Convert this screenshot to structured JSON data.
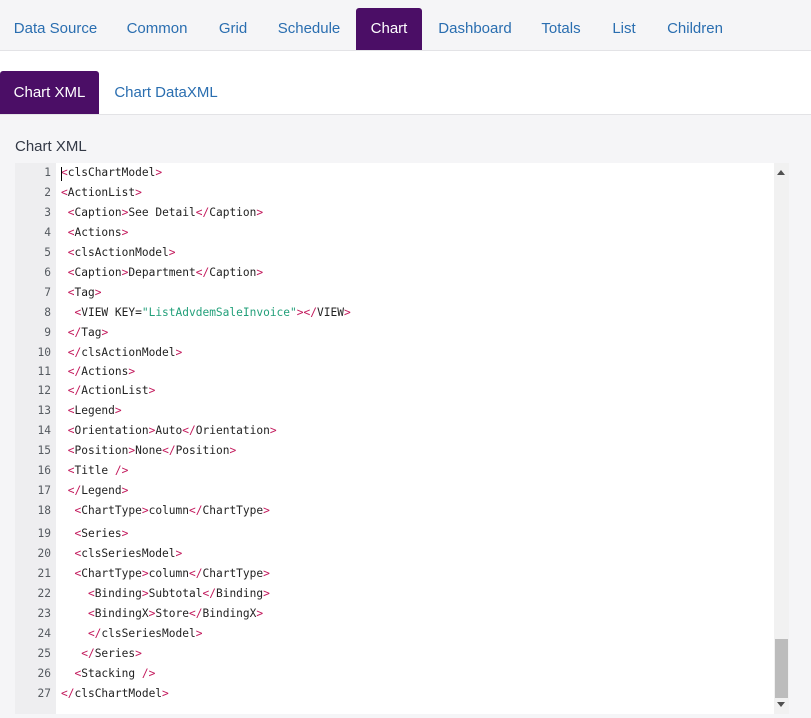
{
  "top_tabs": [
    {
      "label": "Data Source"
    },
    {
      "label": "Common"
    },
    {
      "label": "Grid"
    },
    {
      "label": "Schedule"
    },
    {
      "label": "Chart",
      "active": true
    },
    {
      "label": "Dashboard"
    },
    {
      "label": "Totals"
    },
    {
      "label": "List"
    },
    {
      "label": "Children"
    }
  ],
  "sub_tabs": [
    {
      "label": "Chart XML",
      "active": true
    },
    {
      "label": "Chart DataXML"
    }
  ],
  "section_label": "Chart XML",
  "editor": {
    "line_numbers": [
      "1",
      "2",
      "3",
      "4",
      "5",
      "6",
      "7",
      "8",
      "9",
      "10",
      "11",
      "12",
      "13",
      "14",
      "15",
      "16",
      "17",
      "18",
      "19",
      "20",
      "21",
      "22",
      "23",
      "24",
      "25",
      "26",
      "27"
    ],
    "lines": [
      [
        {
          "t": "<",
          "c": "b"
        },
        {
          "t": "clsChartModel",
          "c": "tag"
        },
        {
          "t": ">",
          "c": "b"
        }
      ],
      [
        {
          "t": "<",
          "c": "b"
        },
        {
          "t": "ActionList",
          "c": "tag"
        },
        {
          "t": ">",
          "c": "b"
        }
      ],
      [
        {
          "t": " <",
          "c": "b"
        },
        {
          "t": "Caption",
          "c": "tag"
        },
        {
          "t": ">",
          "c": "b"
        },
        {
          "t": "See Detail",
          "c": "tag"
        },
        {
          "t": "</",
          "c": "b"
        },
        {
          "t": "Caption",
          "c": "tag"
        },
        {
          "t": ">",
          "c": "b"
        }
      ],
      [
        {
          "t": " <",
          "c": "b"
        },
        {
          "t": "Actions",
          "c": "tag"
        },
        {
          "t": ">",
          "c": "b"
        }
      ],
      [
        {
          "t": " <",
          "c": "b"
        },
        {
          "t": "clsActionModel",
          "c": "tag"
        },
        {
          "t": ">",
          "c": "b"
        }
      ],
      [
        {
          "t": " <",
          "c": "b"
        },
        {
          "t": "Caption",
          "c": "tag"
        },
        {
          "t": ">",
          "c": "b"
        },
        {
          "t": "Department",
          "c": "tag"
        },
        {
          "t": "</",
          "c": "b"
        },
        {
          "t": "Caption",
          "c": "tag"
        },
        {
          "t": ">",
          "c": "b"
        }
      ],
      [
        {
          "t": " <",
          "c": "b"
        },
        {
          "t": "Tag",
          "c": "tag"
        },
        {
          "t": ">",
          "c": "b"
        }
      ],
      [
        {
          "t": "  <",
          "c": "b"
        },
        {
          "t": "VIEW KEY=",
          "c": "tag"
        },
        {
          "t": "\"ListAdvdemSaleInvoice\"",
          "c": "str"
        },
        {
          "t": "></",
          "c": "b"
        },
        {
          "t": "VIEW",
          "c": "tag"
        },
        {
          "t": ">",
          "c": "b"
        }
      ],
      [
        {
          "t": " </",
          "c": "b"
        },
        {
          "t": "Tag",
          "c": "tag"
        },
        {
          "t": ">",
          "c": "b"
        }
      ],
      [
        {
          "t": " </",
          "c": "b"
        },
        {
          "t": "clsActionModel",
          "c": "tag"
        },
        {
          "t": ">",
          "c": "b"
        }
      ],
      [
        {
          "t": " </",
          "c": "b"
        },
        {
          "t": "Actions",
          "c": "tag"
        },
        {
          "t": ">",
          "c": "b"
        }
      ],
      [
        {
          "t": " </",
          "c": "b"
        },
        {
          "t": "ActionList",
          "c": "tag"
        },
        {
          "t": ">",
          "c": "b"
        }
      ],
      [
        {
          "t": " <",
          "c": "b"
        },
        {
          "t": "Legend",
          "c": "tag"
        },
        {
          "t": ">",
          "c": "b"
        }
      ],
      [
        {
          "t": " <",
          "c": "b"
        },
        {
          "t": "Orientation",
          "c": "tag"
        },
        {
          "t": ">",
          "c": "b"
        },
        {
          "t": "Auto",
          "c": "tag"
        },
        {
          "t": "</",
          "c": "b"
        },
        {
          "t": "Orientation",
          "c": "tag"
        },
        {
          "t": ">",
          "c": "b"
        }
      ],
      [
        {
          "t": " <",
          "c": "b"
        },
        {
          "t": "Position",
          "c": "tag"
        },
        {
          "t": ">",
          "c": "b"
        },
        {
          "t": "None",
          "c": "tag"
        },
        {
          "t": "</",
          "c": "b"
        },
        {
          "t": "Position",
          "c": "tag"
        },
        {
          "t": ">",
          "c": "b"
        }
      ],
      [
        {
          "t": " <",
          "c": "b"
        },
        {
          "t": "Title ",
          "c": "tag"
        },
        {
          "t": "/>",
          "c": "b"
        }
      ],
      [
        {
          "t": " </",
          "c": "b"
        },
        {
          "t": "Legend",
          "c": "tag"
        },
        {
          "t": ">",
          "c": "b"
        }
      ],
      [
        {
          "t": "  <",
          "c": "b"
        },
        {
          "t": "ChartType",
          "c": "tag"
        },
        {
          "t": ">",
          "c": "b"
        },
        {
          "t": "column",
          "c": "tag"
        },
        {
          "t": "</",
          "c": "b"
        },
        {
          "t": "ChartType",
          "c": "tag"
        },
        {
          "t": ">",
          "c": "b"
        }
      ],
      [
        {
          "t": "  <",
          "c": "b"
        },
        {
          "t": "Series",
          "c": "tag"
        },
        {
          "t": ">",
          "c": "b"
        }
      ],
      [
        {
          "t": "  <",
          "c": "b"
        },
        {
          "t": "clsSeriesModel",
          "c": "tag"
        },
        {
          "t": ">",
          "c": "b"
        }
      ],
      [
        {
          "t": "  <",
          "c": "b"
        },
        {
          "t": "ChartType",
          "c": "tag"
        },
        {
          "t": ">",
          "c": "b"
        },
        {
          "t": "column",
          "c": "tag"
        },
        {
          "t": "</",
          "c": "b"
        },
        {
          "t": "ChartType",
          "c": "tag"
        },
        {
          "t": ">",
          "c": "b"
        }
      ],
      [
        {
          "t": "    <",
          "c": "b"
        },
        {
          "t": "Binding",
          "c": "tag"
        },
        {
          "t": ">",
          "c": "b"
        },
        {
          "t": "Subtotal",
          "c": "tag"
        },
        {
          "t": "</",
          "c": "b"
        },
        {
          "t": "Binding",
          "c": "tag"
        },
        {
          "t": ">",
          "c": "b"
        }
      ],
      [
        {
          "t": "    <",
          "c": "b"
        },
        {
          "t": "BindingX",
          "c": "tag"
        },
        {
          "t": ">",
          "c": "b"
        },
        {
          "t": "Store",
          "c": "tag"
        },
        {
          "t": "</",
          "c": "b"
        },
        {
          "t": "BindingX",
          "c": "tag"
        },
        {
          "t": ">",
          "c": "b"
        }
      ],
      [
        {
          "t": "    </",
          "c": "b"
        },
        {
          "t": "clsSeriesModel",
          "c": "tag"
        },
        {
          "t": ">",
          "c": "b"
        }
      ],
      [
        {
          "t": "   </",
          "c": "b"
        },
        {
          "t": "Series",
          "c": "tag"
        },
        {
          "t": ">",
          "c": "b"
        }
      ],
      [
        {
          "t": "  <",
          "c": "b"
        },
        {
          "t": "Stacking ",
          "c": "tag"
        },
        {
          "t": "/>",
          "c": "b"
        }
      ],
      [
        {
          "t": "</",
          "c": "b"
        },
        {
          "t": "clsChartModel",
          "c": "tag"
        },
        {
          "t": ">",
          "c": "b"
        }
      ]
    ]
  },
  "colors": {
    "accent": "#4b0e66",
    "link": "#2a6eb0",
    "bracket": "#c2185b",
    "string": "#23a07a"
  }
}
